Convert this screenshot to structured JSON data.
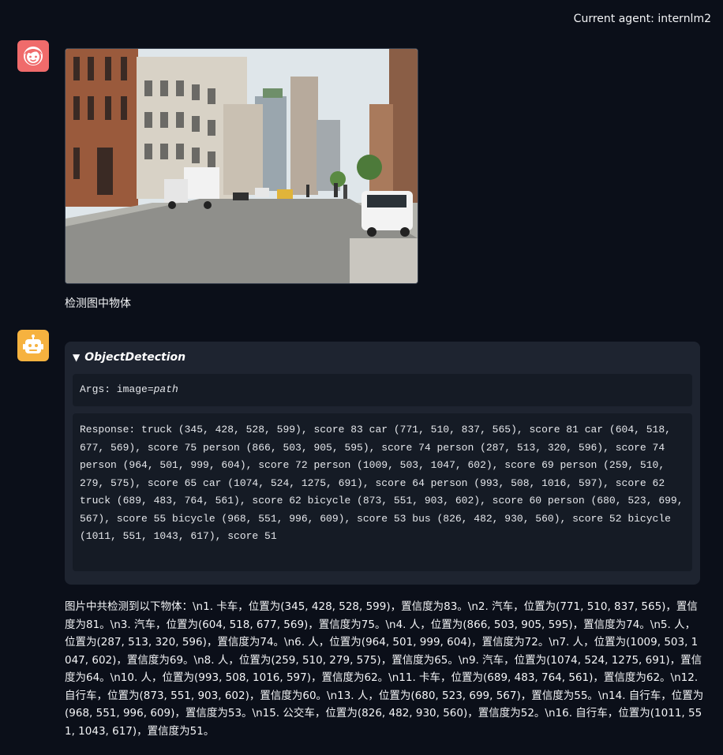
{
  "header": {
    "current_agent_label": "Current agent: internlm2"
  },
  "chat": {
    "user": {
      "avatar_icon": "user-avatar-icon",
      "avatar_color": "#f06b6b",
      "image_alt": "street scene",
      "text": "检测图中物体"
    },
    "assistant": {
      "avatar_icon": "robot-avatar-icon",
      "avatar_color": "#f6b23f",
      "tool_name": "ObjectDetection",
      "args_prefix": "Args: image=",
      "args_value": "path",
      "response": "Response: truck (345, 428, 528, 599), score 83 car (771, 510, 837, 565), score 81 car (604, 518, 677, 569), score 75 person (866, 503, 905, 595), score 74 person (287, 513, 320, 596), score 74 person (964, 501, 999, 604), score 72 person (1009, 503, 1047, 602), score 69 person (259, 510, 279, 575), score 65 car (1074, 524, 1275, 691), score 64 person (993, 508, 1016, 597), score 62 truck (689, 483, 764, 561), score 62 bicycle (873, 551, 903, 602), score 60 person (680, 523, 699, 567), score 55 bicycle (968, 551, 996, 609), score 53 bus (826, 482, 930, 560), score 52 bicycle (1011, 551, 1043, 617), score 51",
      "answer": "图片中共检测到以下物体：\\n1. 卡车，位置为(345, 428, 528, 599)，置信度为83。\\n2. 汽车，位置为(771, 510, 837, 565)，置信度为81。\\n3. 汽车，位置为(604, 518, 677, 569)，置信度为75。\\n4. 人，位置为(866, 503, 905, 595)，置信度为74。\\n5. 人，位置为(287, 513, 320, 596)，置信度为74。\\n6. 人，位置为(964, 501, 999, 604)，置信度为72。\\n7. 人，位置为(1009, 503, 1047, 602)，置信度为69。\\n8. 人，位置为(259, 510, 279, 575)，置信度为65。\\n9. 汽车，位置为(1074, 524, 1275, 691)，置信度为64。\\n10. 人，位置为(993, 508, 1016, 597)，置信度为62。\\n11. 卡车，位置为(689, 483, 764, 561)，置信度为62。\\n12. 自行车，位置为(873, 551, 903, 602)，置信度为60。\\n13. 人，位置为(680, 523, 699, 567)，置信度为55。\\n14. 自行车，位置为(968, 551, 996, 609)，置信度为53。\\n15. 公交车，位置为(826, 482, 930, 560)，置信度为52。\\n16. 自行车，位置为(1011, 551, 1043, 617)，置信度为51。"
    }
  }
}
